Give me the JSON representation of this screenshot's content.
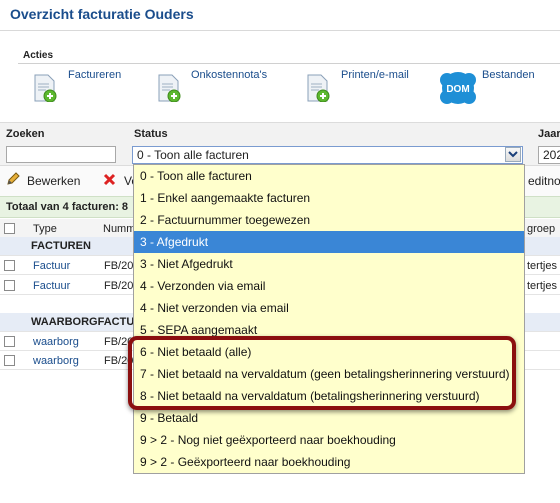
{
  "page": {
    "title": "Overzicht facturatie Ouders"
  },
  "acties": {
    "label": "Acties",
    "items": [
      {
        "label": "Factureren",
        "icon": "document-add-icon"
      },
      {
        "label": "Onkostennota's",
        "icon": "document-add-icon"
      },
      {
        "label": "Printen/e-mail",
        "icon": "document-add-icon"
      },
      {
        "label": "Bestanden",
        "icon": "dom-badge-icon",
        "badge": "DOM"
      }
    ]
  },
  "filters": {
    "zoeken_label": "Zoeken",
    "zoeken_value": "",
    "status_label": "Status",
    "status_value": "0 - Toon alle facturen",
    "jaar_label": "Jaar",
    "jaar_value": "202"
  },
  "toolbar": {
    "bewerken": "Bewerken",
    "verwijderen_partial": "Ve",
    "creditnota_partial": "editno"
  },
  "totals": {
    "text": "Totaal van 4 facturen: 8"
  },
  "table": {
    "headers": {
      "type": "Type",
      "nummer": "Numm",
      "groep": "groep"
    },
    "groups": [
      {
        "label": "FACTUREN",
        "rows": [
          {
            "type": "Factuur",
            "nummer": "FB/202",
            "groep": "tertjes"
          },
          {
            "type": "Factuur",
            "nummer": "FB/202",
            "groep": "tertjes"
          }
        ]
      },
      {
        "label": "WAARBORGFACTUR",
        "rows": [
          {
            "type": "waarborg",
            "nummer": "FB/20",
            "groep": ""
          },
          {
            "type": "waarborg",
            "nummer": "FB/20",
            "groep": ""
          }
        ]
      }
    ]
  },
  "status_options": [
    "0 - Toon alle facturen",
    "1 - Enkel aangemaakte facturen",
    "2 - Factuurnummer toegewezen",
    "3 - Afgedrukt",
    "3 - Niet Afgedrukt",
    "4 - Verzonden via email",
    "4 - Niet verzonden via email",
    "5 - SEPA aangemaakt",
    "6 - Niet betaald (alle)",
    "7 - Niet betaald na vervaldatum (geen betalingsherinnering verstuurd)",
    "8 - Niet betaald na vervaldatum (betalingsherinnering verstuurd)",
    "9 - Betaald",
    "9 > 2 - Nog niet geëxporteerd naar boekhouding",
    "9 > 2 - Geëxporteerd naar boekhouding"
  ],
  "status_selected_index": 3,
  "colors": {
    "accent": "#1a4d8c",
    "highlight_border": "#8b0f0f",
    "dropdown_bg": "#ffffcc",
    "selected_option": "#3a86d6"
  }
}
